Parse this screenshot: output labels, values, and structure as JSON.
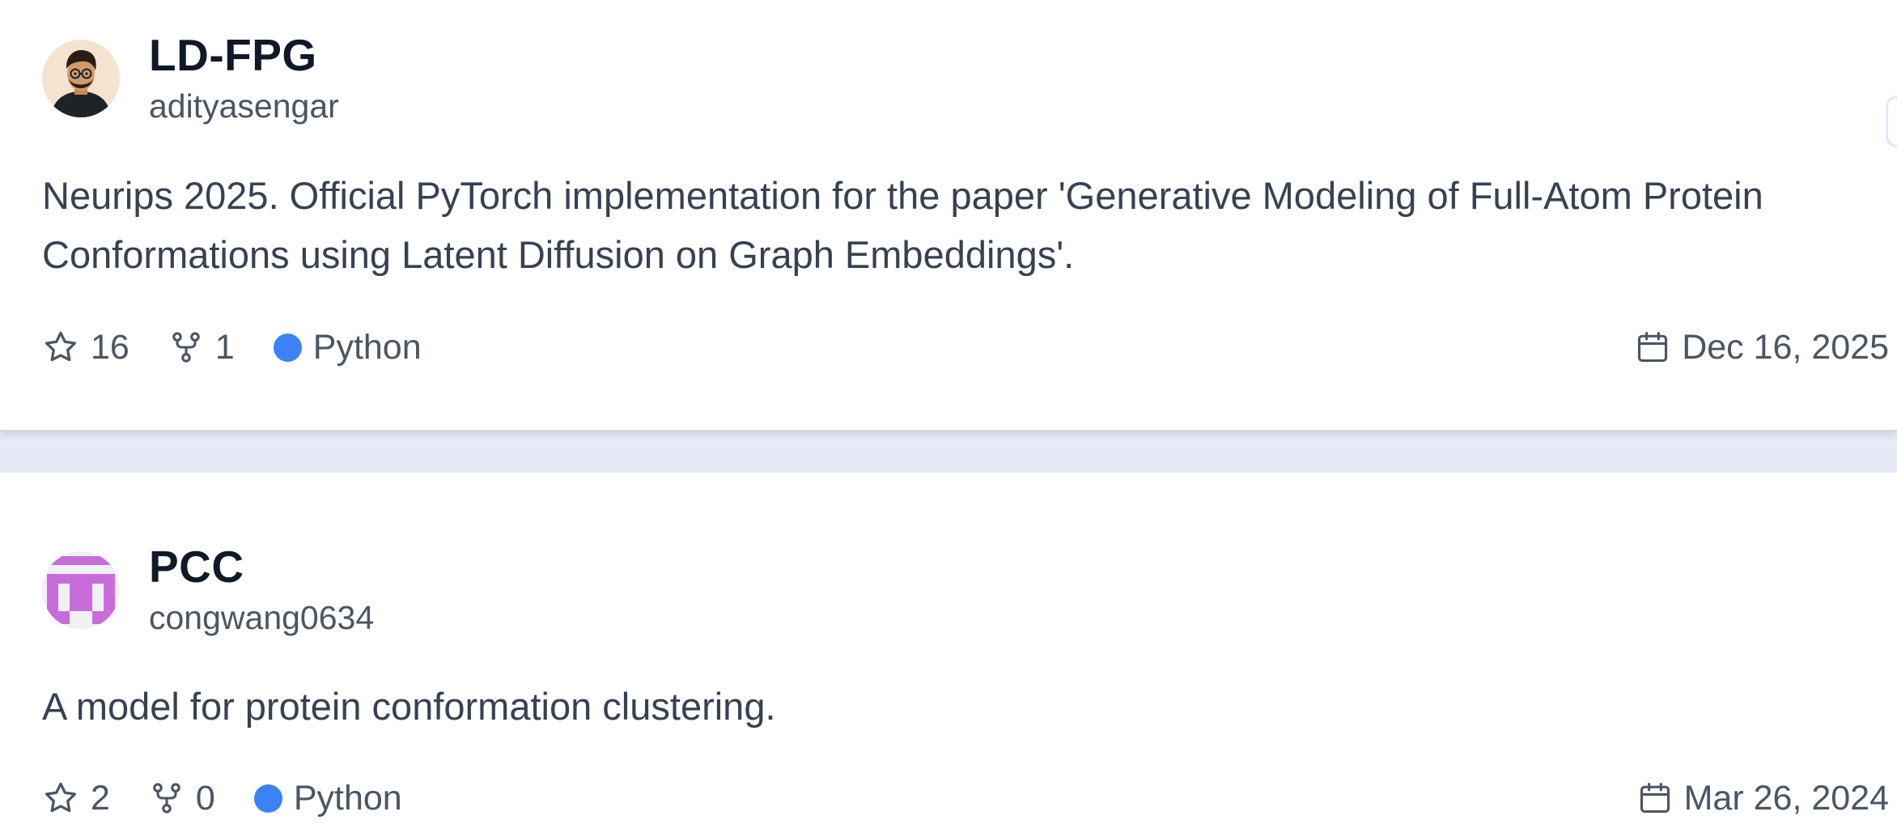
{
  "repos": [
    {
      "name": "LD-FPG",
      "owner": "adityasengar",
      "description": "Neurips 2025. Official PyTorch implementation for the paper 'Generative Modeling of Full-Atom Protein Conformations using Latent Diffusion on Graph Embeddings'.",
      "stars": "16",
      "forks": "1",
      "language": "Python",
      "date": "Dec 16, 2025",
      "avatar_icon": "person-avatar"
    },
    {
      "name": "PCC",
      "owner": "congwang0634",
      "description": "A model for protein conformation clustering.",
      "stars": "2",
      "forks": "0",
      "language": "Python",
      "date": "Mar 26, 2024",
      "avatar_icon": "identicon-avatar"
    }
  ],
  "colors": {
    "python_language": "#3b82f6",
    "identicon": "#c86cdc",
    "page_background": "#e6e9f6"
  },
  "icons": {
    "star": "star-icon",
    "fork": "fork-icon",
    "calendar": "calendar-icon"
  }
}
